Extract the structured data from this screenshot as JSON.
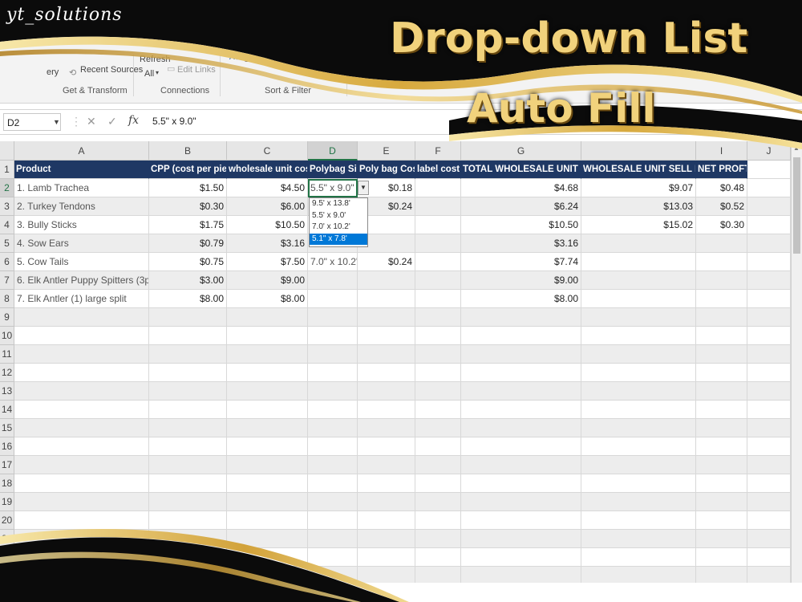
{
  "brand": "yt_solutions",
  "title": {
    "line1": "Drop-down List",
    "line2": "Auto Fill"
  },
  "ribbon": {
    "query_partial": "ery",
    "recent_sources": "Recent Sources",
    "refresh": "Refresh",
    "all": "All",
    "edit_links": "Edit Links",
    "sort": "Sort",
    "filter": "Filter",
    "advanced": "Advanced",
    "groups": {
      "get_transform": "Get & Transform",
      "connections": "Connections",
      "sort_filter": "Sort & Filter"
    }
  },
  "formula_bar": {
    "name_box": "D2",
    "fx": "fx",
    "value": "5.5\" x 9.0\""
  },
  "columns": [
    "A",
    "B",
    "C",
    "D",
    "E",
    "F",
    "G",
    "",
    "I",
    "J"
  ],
  "header_row": [
    "Product",
    "CPP (cost per piece)",
    "wholesale unit cost $",
    "Polybag Size",
    "Poly bag Cost $",
    "label cost $",
    "TOTAL WHOLESALE UNIT COST $",
    "WHOLESALE UNIT SELL PRICE $",
    "NET PROFT %"
  ],
  "rows": [
    [
      "1. Lamb Trachea",
      "$1.50",
      "$4.50",
      "5.5\" x 9.0\"",
      "$0.18",
      "",
      "$4.68",
      "$9.07",
      "$0.48"
    ],
    [
      "2. Turkey Tendons",
      "$0.30",
      "$6.00",
      "",
      "$0.24",
      "",
      "$6.24",
      "$13.03",
      "$0.52"
    ],
    [
      "3. Bully Sticks",
      "$1.75",
      "$10.50",
      "",
      "",
      "",
      "$10.50",
      "$15.02",
      "$0.30"
    ],
    [
      "4. Sow Ears",
      "$0.79",
      "$3.16",
      "",
      "",
      "",
      "$3.16",
      "",
      ""
    ],
    [
      "5. Cow Tails",
      "$0.75",
      "$7.50",
      "7.0\" x 10.2\"",
      "$0.24",
      "",
      "$7.74",
      "",
      ""
    ],
    [
      "6. Elk Antler Puppy Spitters (3pk)",
      "$3.00",
      "$9.00",
      "",
      "",
      "",
      "$9.00",
      "",
      ""
    ],
    [
      "7. Elk Antler (1) large split",
      "$8.00",
      "$8.00",
      "",
      "",
      "",
      "$8.00",
      "",
      ""
    ]
  ],
  "row_numbers": [
    "1",
    "2",
    "3",
    "4",
    "5",
    "6",
    "7",
    "8",
    "9",
    "10",
    "11",
    "12",
    "13",
    "14",
    "15",
    "16",
    "17",
    "18",
    "19",
    "20",
    "21",
    "22",
    "23"
  ],
  "dropdown": {
    "options": [
      "9.5' x 13.8'",
      "5.5' x 9.0'",
      "7.0' x 10.2'",
      "5.1\" x 7.8'"
    ],
    "highlighted_index": 3
  }
}
